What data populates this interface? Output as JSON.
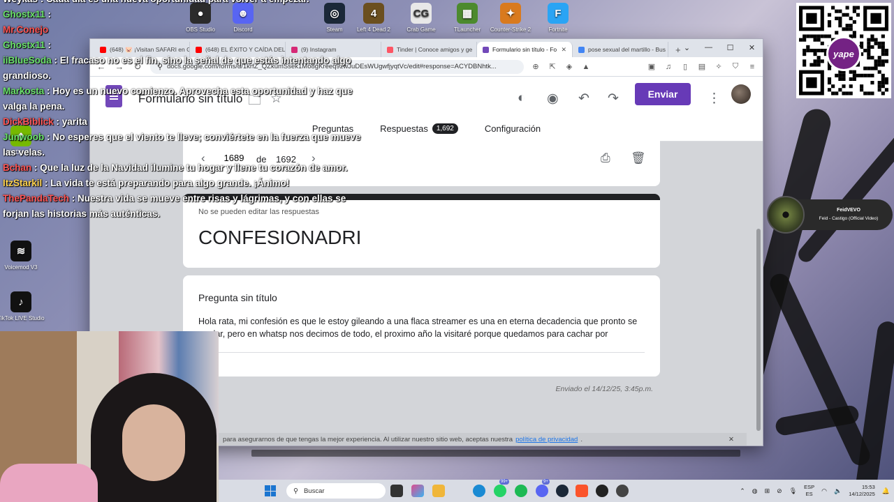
{
  "desktop": {
    "icons": [
      {
        "label": "OBS Studio",
        "name": "obs-icon",
        "color": "#2b2b2b",
        "glyph": "●"
      },
      {
        "label": "Discord",
        "name": "discord-icon",
        "color": "#5865f2",
        "glyph": "☻"
      },
      {
        "label": "Steam",
        "name": "steam-icon",
        "color": "#1b2838",
        "glyph": "◎"
      },
      {
        "label": "Left 4 Dead 2",
        "name": "l4d2-icon",
        "color": "#6b4f1f",
        "glyph": "4"
      },
      {
        "label": "Crab Game",
        "name": "crab-game-icon",
        "color": "#e8e8e8",
        "glyph": "CG"
      },
      {
        "label": "TLauncher",
        "name": "tlauncher-icon",
        "color": "#4c8a2e",
        "glyph": "▦"
      },
      {
        "label": "Counter-Strike 2",
        "name": "cs2-icon",
        "color": "#d97a1e",
        "glyph": "✦"
      },
      {
        "label": "Fortnite",
        "name": "fortnite-icon",
        "color": "#2aa4f4",
        "glyph": "F"
      }
    ],
    "left_icons": [
      {
        "label": "NVIDIA App",
        "name": "nvidia-icon",
        "color": "#76b900",
        "glyph": "◆"
      },
      {
        "label": "Voicemod V3",
        "name": "voicemod-icon",
        "color": "#111111",
        "glyph": "≋"
      },
      {
        "label": "TikTok LIVE Studio",
        "name": "tiktok-icon",
        "color": "#111111",
        "glyph": "♪"
      }
    ]
  },
  "chat": [
    {
      "user": "Weykas",
      "color": "#ffffff",
      "text": ": Cada día es una nueva oportunidad para volver a empezar."
    },
    {
      "user": "Ghostx11",
      "color": "#6be36b",
      "text": ":"
    },
    {
      "user": "Mr.Conejo",
      "color": "#ff5555",
      "text": ""
    },
    {
      "user": "Ghostx11",
      "color": "#6be36b",
      "text": ":"
    },
    {
      "user": "iiBlueSoda",
      "color": "#6be36b",
      "text": ": El fracaso no es el fin, sino la señal de que estás intentando algo grandioso."
    },
    {
      "user": "Markosta",
      "color": "#6be36b",
      "text": ": Hoy es un nuevo comienzo. Aprovecha esta oportunidad y haz que valga la pena."
    },
    {
      "user": "DickBiblick",
      "color": "#ff5555",
      "text": ": yarita"
    },
    {
      "user": "Junwoob",
      "color": "#6be36b",
      "text": ": No esperes que el viento te lleve; conviértete en la fuerza que mueve las velas."
    },
    {
      "user": "Bchan",
      "color": "#ff5555",
      "text": ": Que la luz de la Navidad ilumine tu hogar y llene tu corazón de amor."
    },
    {
      "user": "ItzStarkil",
      "color": "#ffd34d",
      "text": ": La vida te está preparando para algo grande. ¡Ánimo!"
    },
    {
      "user": "ThePandaTech",
      "color": "#ff5555",
      "text": ": Nuestra vida se mueve entre risas y lágrimas, y con ellas se forjan las historias más auténticas."
    }
  ],
  "browser": {
    "tabs": [
      {
        "label": "(648) 🐷 ¡Visitan SAFARI en G",
        "color": "#ff0000",
        "active": false
      },
      {
        "label": "(648) EL ÉXITO Y CAÍDA DEL",
        "color": "#ff0000",
        "active": false
      },
      {
        "label": "(9) Instagram",
        "color": "#d62976",
        "active": false
      },
      {
        "label": "Tinder | Conoce amigos y ge",
        "color": "#fd5564",
        "active": false
      },
      {
        "label": "Formulario sin título - Fo",
        "color": "#7248b9",
        "active": true
      },
      {
        "label": "pose sexual del martillo - Bus",
        "color": "#4285f4",
        "active": false
      }
    ],
    "url": "docs.google.com/forms/d/1krfZ_QZkumSsek1Mo8gKreeq9zwJuDEsWUgwfjyqtVc/edit#response=ACYDBNhtk...",
    "new_tab": "+"
  },
  "form": {
    "title": "Formulario sin título",
    "send_label": "Enviar",
    "tabs": [
      {
        "label": "Preguntas",
        "active": false
      },
      {
        "label": "Respuestas",
        "active": true,
        "badge": "1,692"
      },
      {
        "label": "Configuración",
        "active": false
      }
    ],
    "pager": {
      "current": "1689",
      "of_label": "de",
      "total": "1692"
    },
    "note": "No se pueden editar las respuestas",
    "response_title": "CONFESIONADRI",
    "question_title": "Pregunta sin título",
    "answer": "Hola rata, mi confesión es que le estoy gileando a una flaca streamer es una en eterna decadencia que pronto se mudar, pero en whatsp nos decimos de todo, el proximo año la visitaré porque quedamos para cachar por",
    "sent": "Enviado el 14/12/25, 3:45p.m."
  },
  "cookie": {
    "text": "para asegurarnos de que tengas la mejor experiencia. Al utilizar nuestro sitio web, aceptas nuestra",
    "link": "política de privacidad",
    "suffix": ".",
    "close": "✕"
  },
  "yape": {
    "label": "yape"
  },
  "now_playing": {
    "artist": "FeidVEVO",
    "song": "Feid - Castigo (Official Video)"
  },
  "taskbar": {
    "search_placeholder": "Buscar",
    "lang_top": "ESP",
    "lang_bottom": "ES",
    "time": "15:53",
    "date": "14/12/2025",
    "badge_whatsapp": "99+",
    "badge_discord": "9+"
  }
}
